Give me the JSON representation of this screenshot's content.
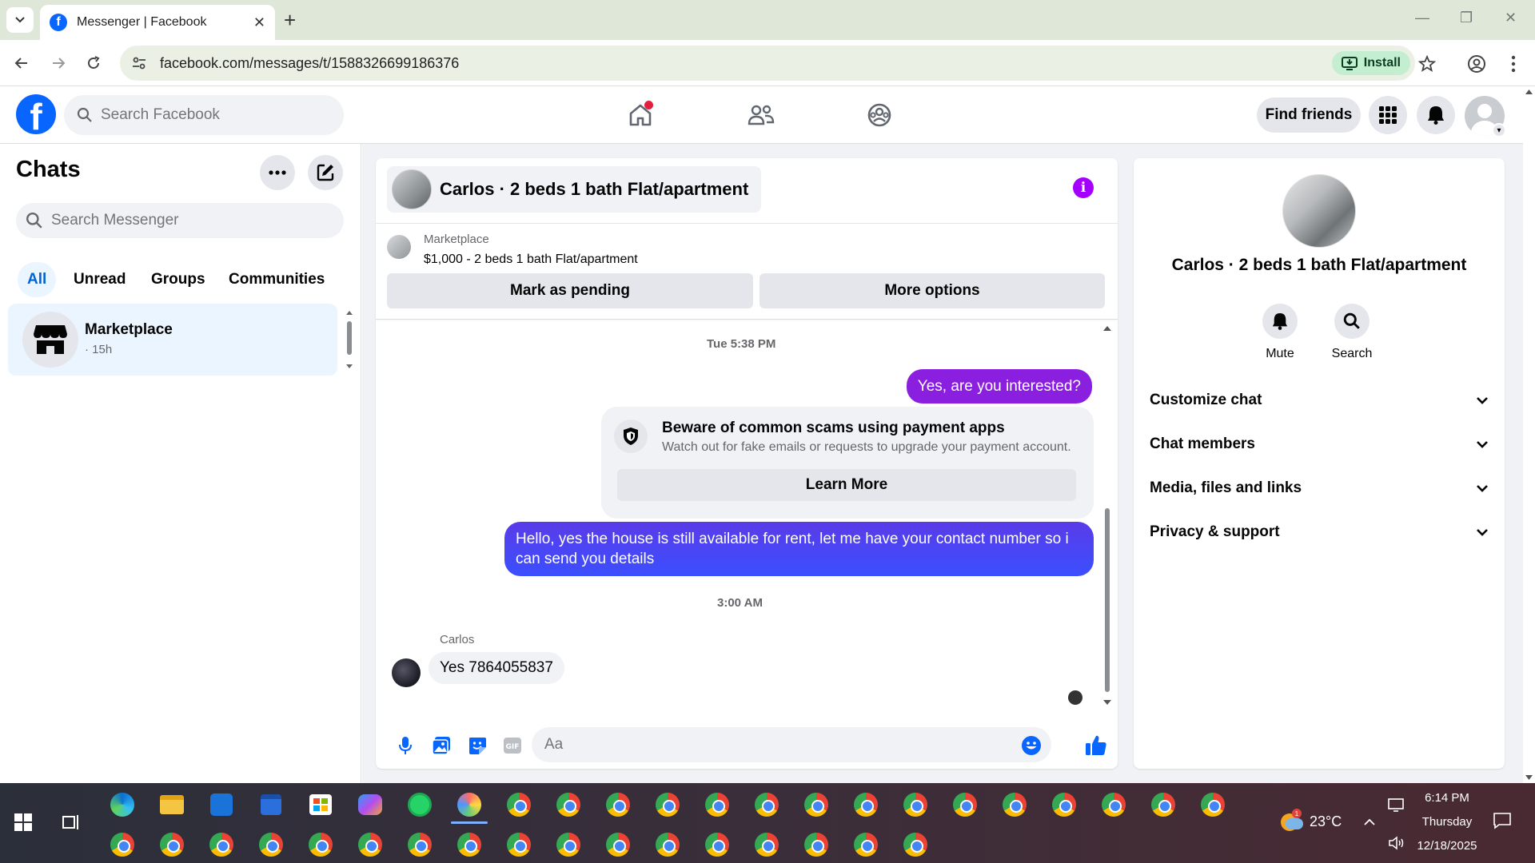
{
  "browser": {
    "tab_title": "Messenger | Facebook",
    "url": "facebook.com/messages/t/1588326699186376",
    "install_label": "Install"
  },
  "header": {
    "search_placeholder": "Search Facebook",
    "find_friends_label": "Find friends"
  },
  "sidebar": {
    "title": "Chats",
    "search_placeholder": "Search Messenger",
    "filters": [
      "All",
      "Unread",
      "Groups",
      "Communities"
    ],
    "active_filter": "All",
    "chats": [
      {
        "name": "Marketplace",
        "time": "· 15h"
      }
    ]
  },
  "chat": {
    "title": "Carlos · 2 beds 1 bath Flat/apartment",
    "marketplace_label": "Marketplace",
    "listing": "$1,000 - 2 beds 1 bath Flat/apartment",
    "mark_pending_label": "Mark as pending",
    "more_options_label": "More options",
    "messages": [
      {
        "type": "timestamp",
        "text": "Tue 5:38 PM"
      },
      {
        "type": "outgoing",
        "text": "Yes, are you interested?"
      },
      {
        "type": "notice",
        "heading": "Beware of common scams using payment apps",
        "body": "Watch out for fake emails or requests to upgrade your payment account.",
        "button": "Learn More"
      },
      {
        "type": "outgoing",
        "text": "Hello, yes the house is still available for rent, let me have your contact number so i can send you details"
      },
      {
        "type": "timestamp",
        "text": "3:00 AM"
      },
      {
        "type": "incoming",
        "sender": "Carlos",
        "text": "Yes 7864055837"
      }
    ],
    "composer_placeholder": "Aa"
  },
  "details": {
    "name": "Carlos · 2 beds 1 bath Flat/apartment",
    "actions": [
      "Mute",
      "Search"
    ],
    "sections": [
      "Customize chat",
      "Chat members",
      "Media, files and links",
      "Privacy & support"
    ]
  },
  "taskbar": {
    "temperature": "23°C",
    "weather_badge": "1",
    "time": "6:14 PM",
    "day": "Thursday",
    "date": "12/18/2025"
  },
  "colors": {
    "fb_blue": "#0866ff",
    "messenger_purple": "#8a1fe0",
    "messenger_blue": "#3b4fff",
    "selected_chat_bg": "#ebf5ff"
  }
}
